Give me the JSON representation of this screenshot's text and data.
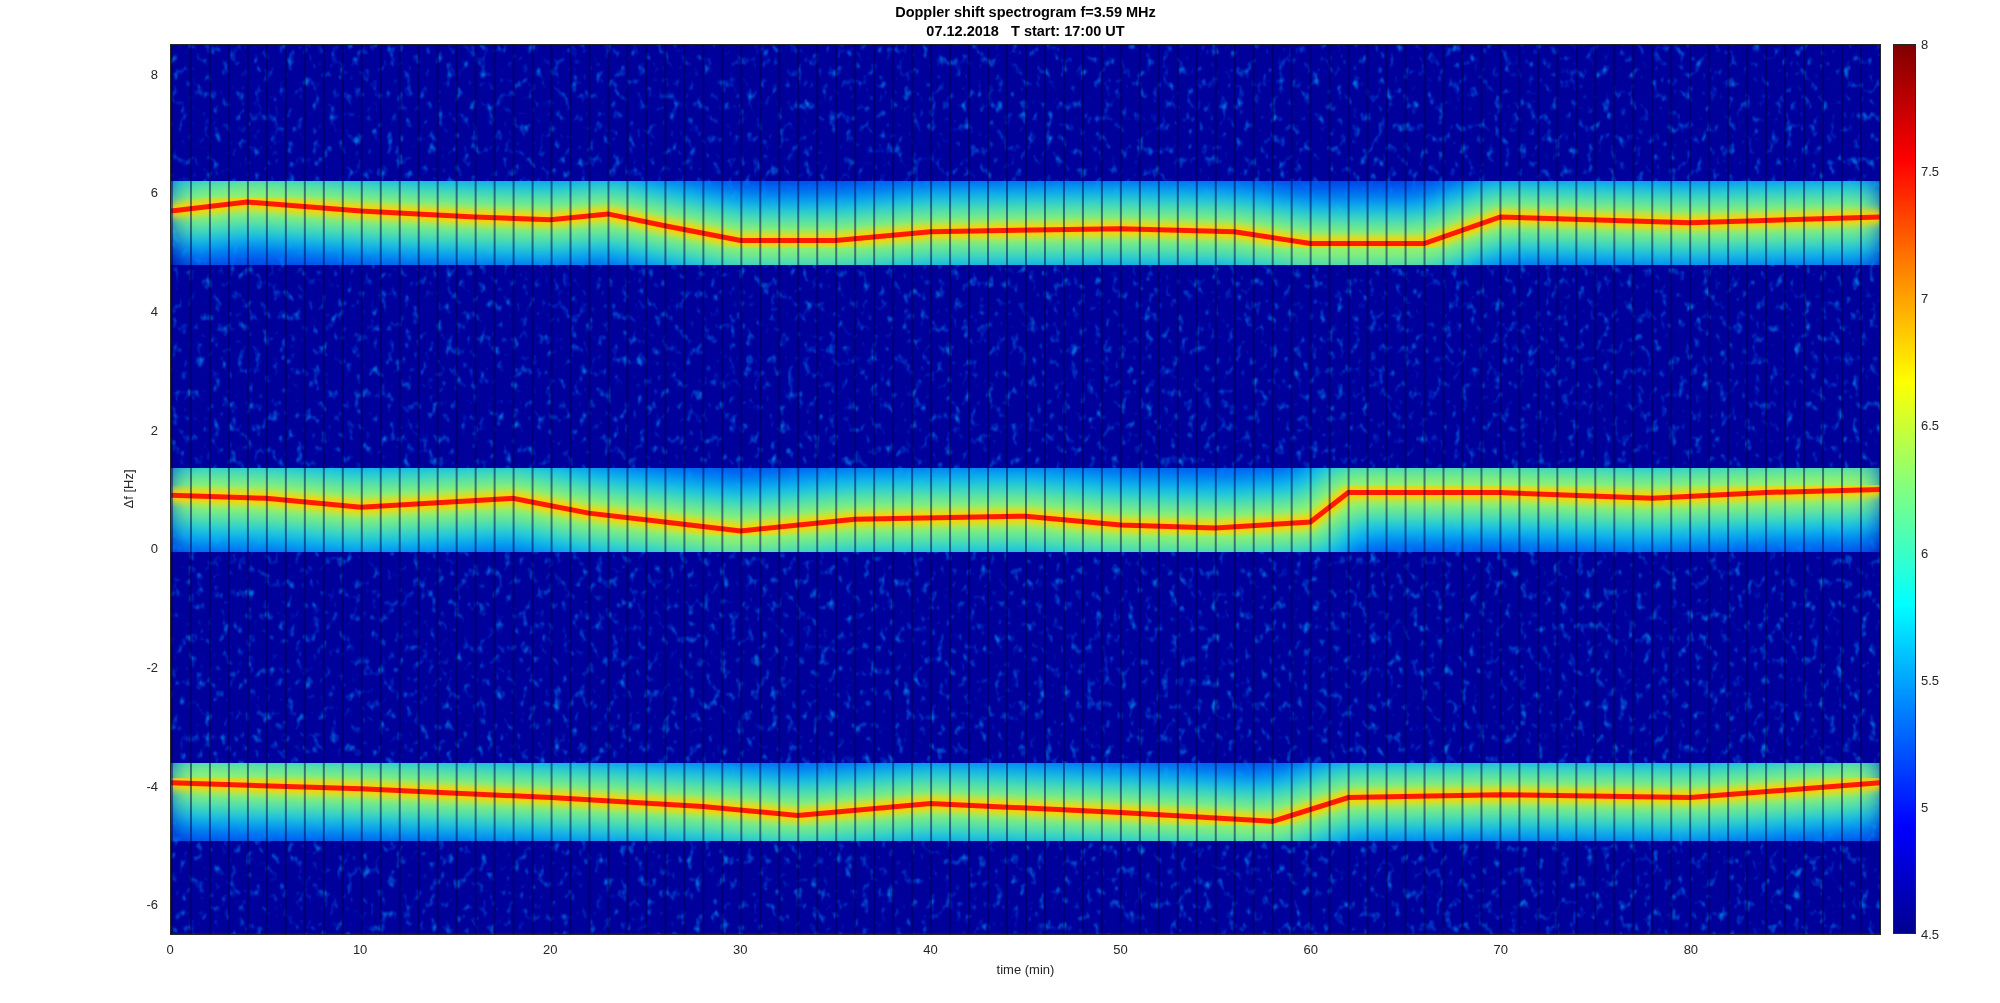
{
  "figure": {
    "title": "Doppler shift spectrogram f=3.59 MHz",
    "subtitle": "07.12.2018   T start: 17:00 UT",
    "xlabel": "time (min)",
    "ylabel": "Δf [Hz]",
    "xticks": [
      "0",
      "10",
      "20",
      "30",
      "40",
      "50",
      "60",
      "70",
      "80"
    ],
    "yticks": [
      "8",
      "6",
      "4",
      "2",
      "0",
      "-2",
      "-4",
      "-6"
    ],
    "colorbar": {
      "ticks": [
        "8",
        "7.5",
        "7",
        "6.5",
        "6",
        "5.5",
        "5",
        "4.5"
      ]
    }
  }
}
